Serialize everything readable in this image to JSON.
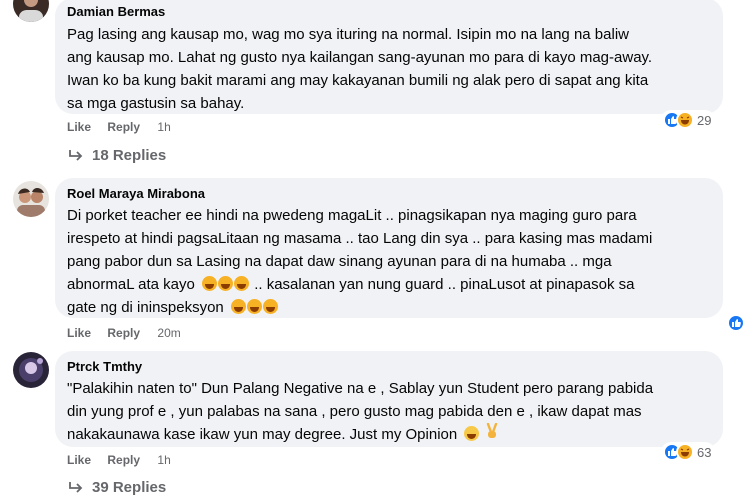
{
  "comments": [
    {
      "author": "Damian Bermas",
      "lines": [
        "Pag lasing ang kausap mo, wag mo sya ituring na normal. Isipin mo na lang na baliw",
        "ang kausap mo. Lahat ng gusto nya kailangan sang-ayunan mo para di kayo mag-away.",
        "Iwan ko ba kung bakit marami ang may kakayanan bumili ng alak pero di sapat ang kita",
        "sa mga gastusin sa bahay."
      ],
      "like_label": "Like",
      "reply_label": "Reply",
      "time": "1h",
      "reaction_count": "29",
      "replies_label": "18 Replies"
    },
    {
      "author": "Roel Maraya Mirabona",
      "lines": [
        "Di porket teacher ee hindi na pwedeng magaLit .. pinagsikapan nya maging guro para",
        "irespeto at hindi pagsaLitaan ng masama .. tao Lang din sya .. para kasing mas madami",
        "pang pabor dun sa Lasing na dapat daw sinang ayunan para di na humaba .. mga",
        "abnormaL ata kayo",
        ".. kasalanan yan nung guard .. pinaLusot at pinapasok sa",
        "gate ng di ininspeksyon"
      ],
      "like_label": "Like",
      "reply_label": "Reply",
      "time": "20m"
    },
    {
      "author": "Ptrck Tmthy",
      "lines": [
        "\"Palakihin naten to\" Dun Palang Negative na e , Sablay yun Student pero parang pabida",
        "din yung prof e , yun palabas na sana , pero gusto mag pabida den e , ikaw dapat mas",
        "nakakaunawa kase ikaw yun may degree. Just my Opinion"
      ],
      "like_label": "Like",
      "reply_label": "Reply",
      "time": "1h",
      "reaction_count": "63",
      "replies_label": "39 Replies"
    }
  ],
  "icons": {
    "like": "like-reaction-icon",
    "haha": "haha-reaction-icon",
    "reply_arrow": "reply-arrow-icon"
  },
  "colors": {
    "bubble": "#f0f2f5",
    "like_blue": "#1877f2",
    "haha_yellow": "#f7b125",
    "muted": "#65676b"
  }
}
